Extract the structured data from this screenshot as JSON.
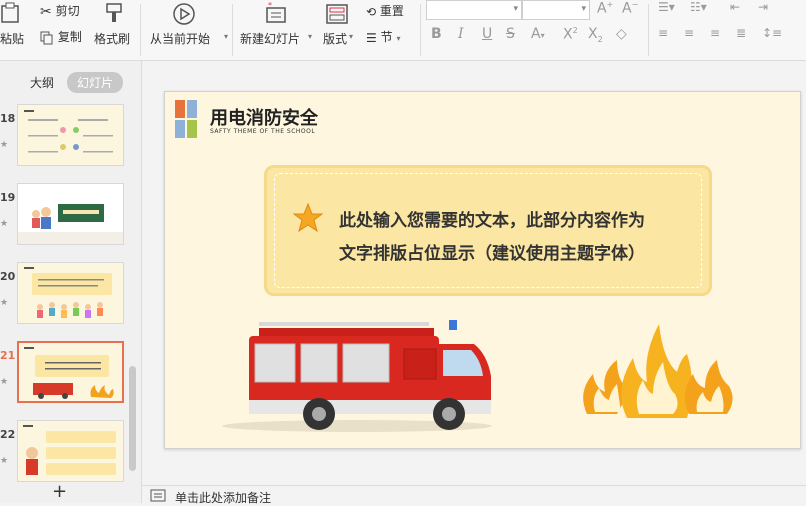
{
  "toolbar": {
    "paste": "粘贴",
    "cut": "剪切",
    "copy": "复制",
    "format_painter": "格式刷",
    "from_current": "从当前开始",
    "new_slide": "新建幻灯片",
    "layout": "版式",
    "reset": "重置",
    "section": "节"
  },
  "sidebar": {
    "tab_outline": "大纲",
    "tab_slides": "幻灯片",
    "slides": [
      {
        "num": "18"
      },
      {
        "num": "19"
      },
      {
        "num": "20"
      },
      {
        "num": "21"
      },
      {
        "num": "22"
      }
    ],
    "add": "+"
  },
  "slide": {
    "title": "用电消防安全",
    "subtitle": "SAFTY THEME OF THE SCHOOL",
    "body_line1": "此处输入您需要的文本，此部分内容作为",
    "body_line2": "文字排版占位显示（建议使用主题字体）"
  },
  "notes": {
    "placeholder": "单击此处添加备注"
  },
  "colors": {
    "accent_selected": "#e8704f",
    "slide_bg": "#fef6de",
    "card": "#fbe7a3"
  }
}
